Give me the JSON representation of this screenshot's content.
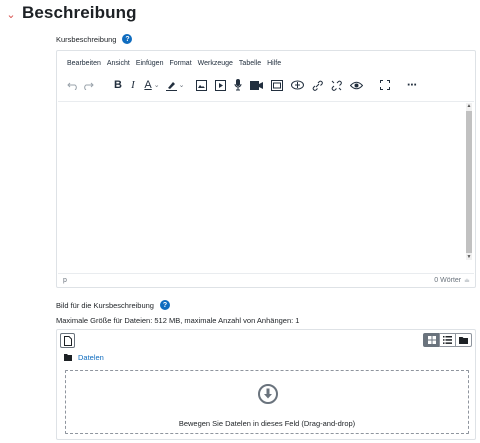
{
  "section": {
    "title": "Beschreibung"
  },
  "course_description": {
    "label": "Kursbeschreibung",
    "help_label": "?"
  },
  "editor": {
    "menu": [
      "Bearbeiten",
      "Ansicht",
      "Einfügen",
      "Format",
      "Werkzeuge",
      "Tabelle",
      "Hilfe"
    ],
    "toolbar_icons": [
      "undo-icon",
      "redo-icon",
      "bold-icon",
      "italic-icon",
      "text-color-icon",
      "highlight-color-icon",
      "image-icon",
      "media-icon",
      "record-audio-icon",
      "record-video-icon",
      "h5p-icon",
      "accessibility-icon",
      "link-icon",
      "unlink-icon",
      "preview-icon",
      "fullscreen-icon",
      "more-icon"
    ],
    "bold_label": "B",
    "italic_label": "I",
    "text_color_label": "A",
    "path": "p",
    "word_count": "0 Wörter"
  },
  "image_field": {
    "label": "Bild für die Kursbeschreibung",
    "help_label": "?",
    "info": "Maximale Größe für Dateien: 512 MB, maximale Anzahl von Anhängen: 1",
    "folder": "Datelen",
    "drop_text": "Bewegen Sie Datelen in dieses Feld (Drag-and-drop)"
  },
  "colors": {
    "accent": "#0f6cbf",
    "chevron": "#d9534f"
  }
}
